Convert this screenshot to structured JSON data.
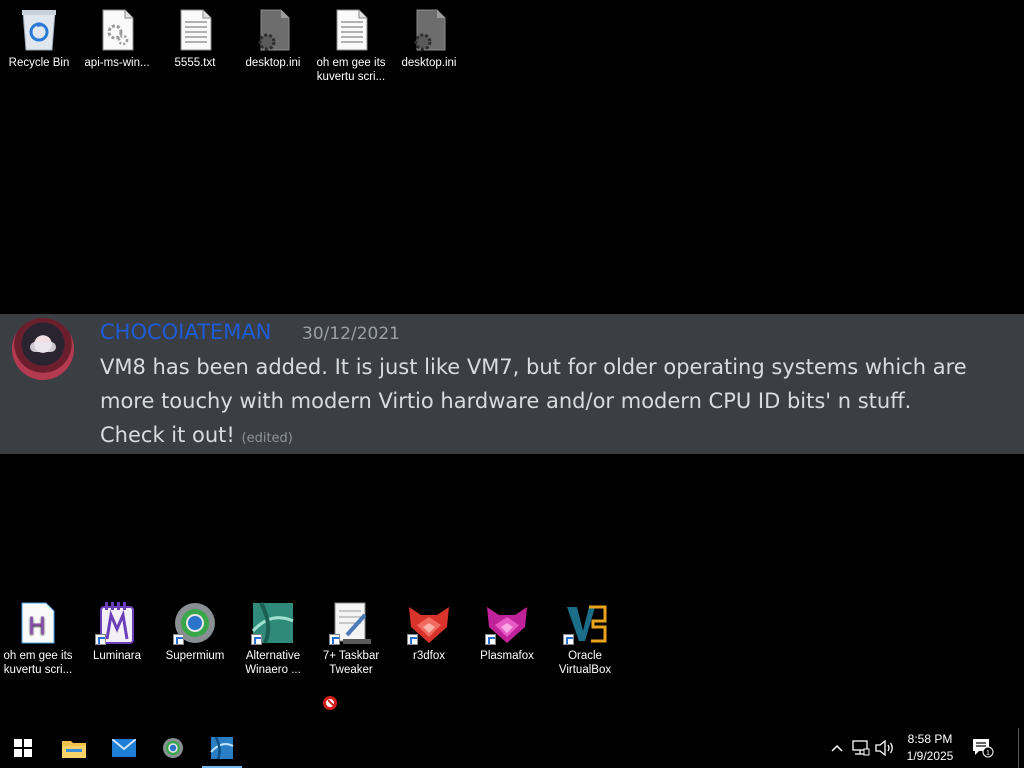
{
  "desktop_icons_top": [
    {
      "name": "recycle-bin",
      "label": "Recycle Bin"
    },
    {
      "name": "api-ms-win-file",
      "label": "api-ms-win..."
    },
    {
      "name": "5555-txt",
      "label": "5555.txt"
    },
    {
      "name": "desktop-ini-1",
      "label": "desktop.ini"
    },
    {
      "name": "kuvertu-script-file",
      "label": "oh em gee its kuvertu scri..."
    },
    {
      "name": "desktop-ini-2",
      "label": "desktop.ini"
    }
  ],
  "desktop_icons_bottom": [
    {
      "name": "kuvertu-script-h",
      "label": "oh em gee its kuvertu scri..."
    },
    {
      "name": "luminara",
      "label": "Luminara"
    },
    {
      "name": "supermium",
      "label": "Supermium"
    },
    {
      "name": "alternative-winaero",
      "label": "Alternative Winaero ..."
    },
    {
      "name": "seven-plus-taskbar-tweaker",
      "label": "7+ Taskbar Tweaker"
    },
    {
      "name": "r3dfox",
      "label": "r3dfox"
    },
    {
      "name": "plasmafox",
      "label": "Plasmafox"
    },
    {
      "name": "oracle-virtualbox",
      "label": "Oracle VirtualBox"
    }
  ],
  "chat": {
    "username": "CHOCOIATEMAN",
    "date": "30/12/2021",
    "message_line1": "VM8 has been added. It is just like VM7, but for older operating systems which are more touchy with modern Virtio hardware and/or modern CPU ID bits' n stuff.",
    "message_line2": "Check it out!",
    "edited_tag": "(edited)",
    "username_color": "#1e5bd6"
  },
  "taskbar": {
    "start_icon": "windows-logo-icon",
    "pinned": [
      "file-explorer-icon",
      "mail-icon",
      "supermium-icon",
      "winaero-icon"
    ],
    "tray_icons": [
      "chevron-up-icon",
      "network-icon",
      "volume-icon"
    ],
    "time": "8:58 PM",
    "date": "1/9/2025",
    "notification_count": "1"
  }
}
